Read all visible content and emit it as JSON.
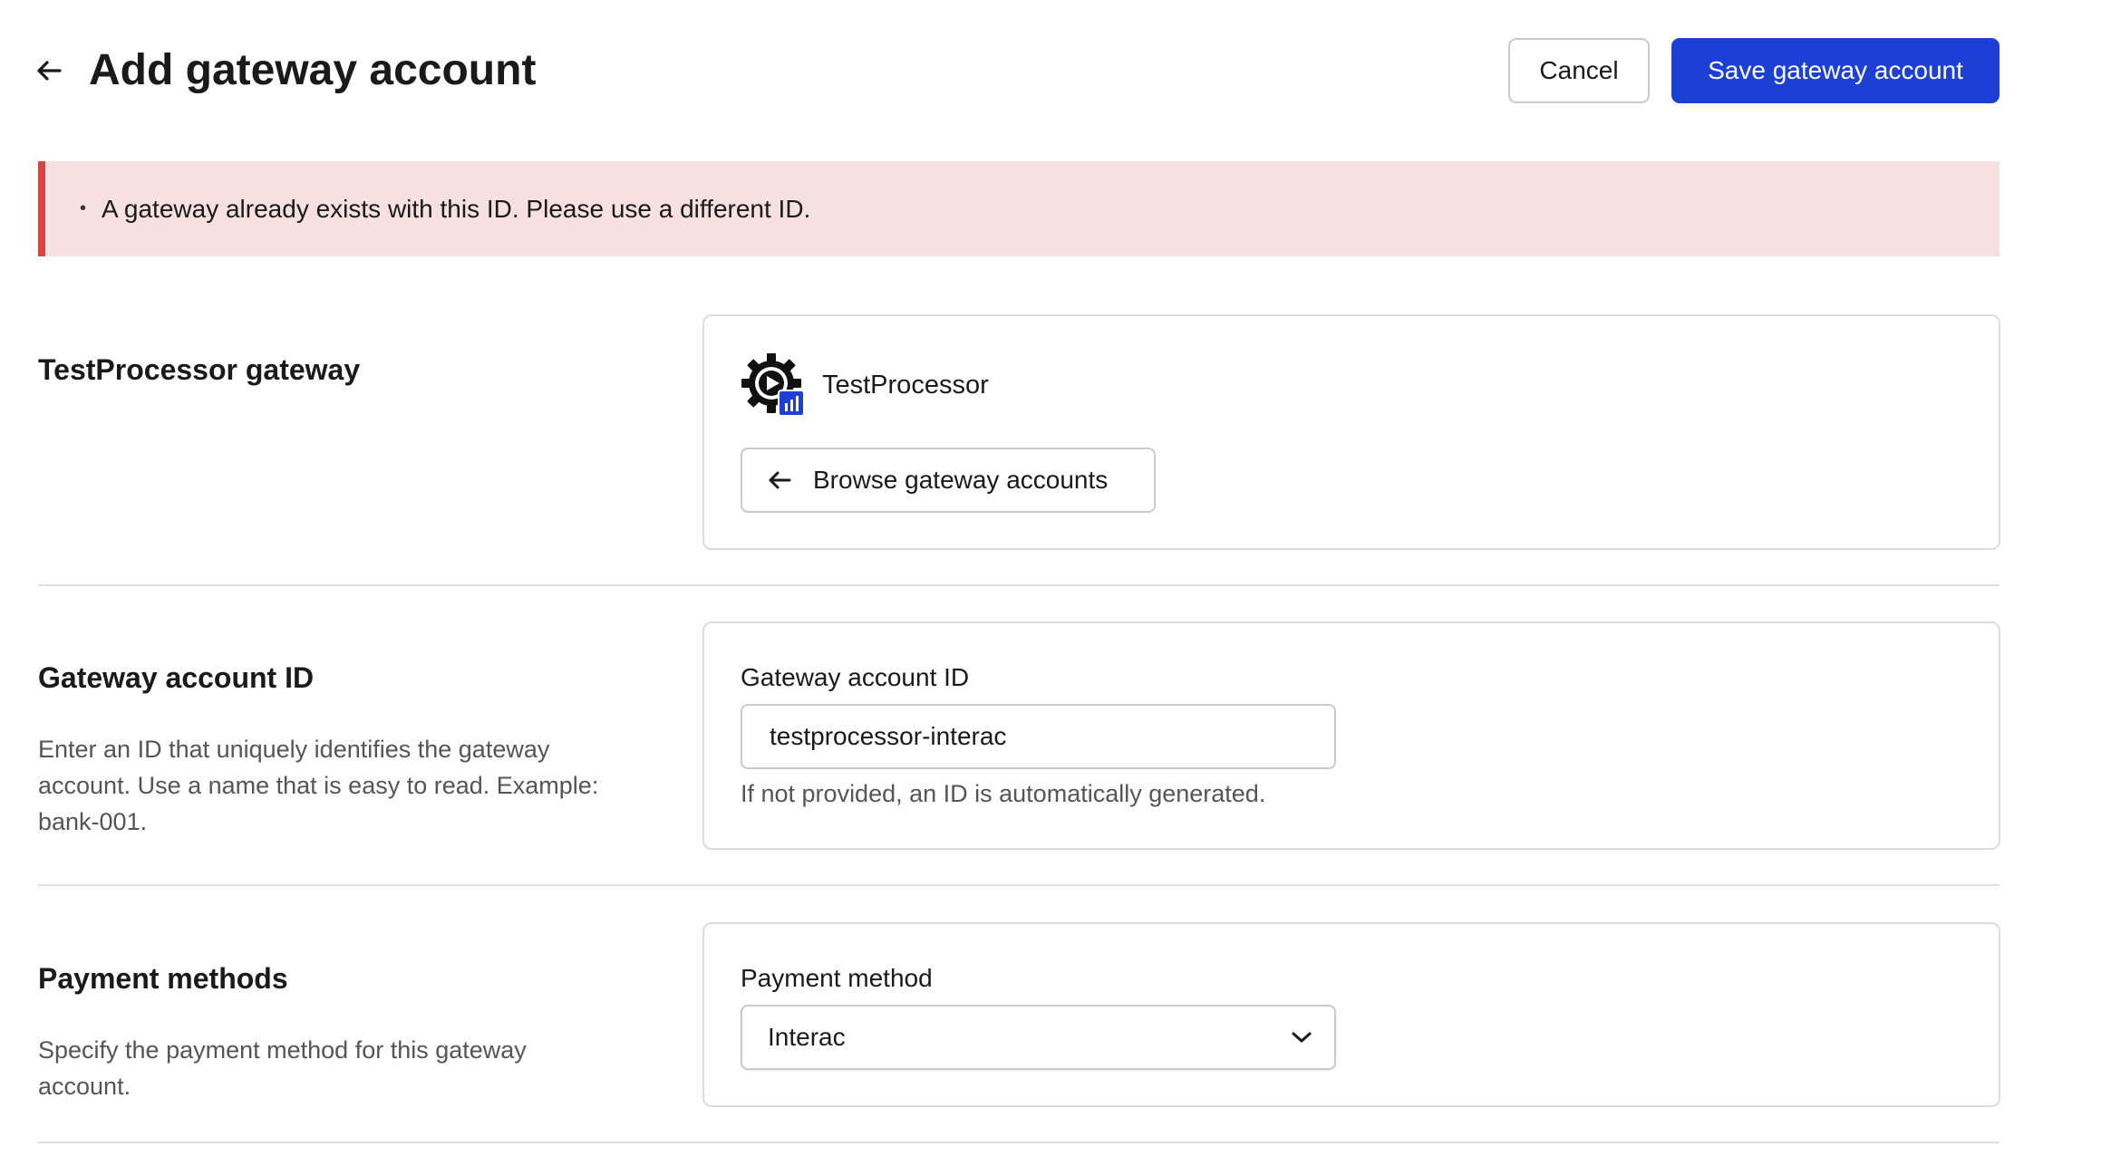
{
  "header": {
    "title": "Add gateway account",
    "cancel_label": "Cancel",
    "save_label": "Save gateway account"
  },
  "error": {
    "bullet": "•",
    "message": "A gateway already exists with this ID. Please use a different ID."
  },
  "gateway_section": {
    "title": "TestProcessor gateway",
    "processor_name": "TestProcessor",
    "browse_label": "Browse gateway accounts"
  },
  "account_id_section": {
    "title": "Gateway account ID",
    "description": "Enter an ID that uniquely identifies the gateway account. Use a name that is easy to read. Example: bank-001.",
    "field_label": "Gateway account ID",
    "field_value": "testprocessor-interac",
    "help_text": "If not provided, an ID is automatically generated."
  },
  "payment_section": {
    "title": "Payment methods",
    "description": "Specify the payment method for this gateway account.",
    "field_label": "Payment method",
    "selected_value": "Interac"
  },
  "colors": {
    "primary": "#1c3fd6",
    "error_bg": "#f6e0e0",
    "error_border": "#d94545"
  },
  "icons": {
    "back": "arrow-left-icon",
    "gateway_logo": "gear-play-chart-icon",
    "browse": "arrow-left-icon",
    "select": "chevron-down-icon"
  }
}
